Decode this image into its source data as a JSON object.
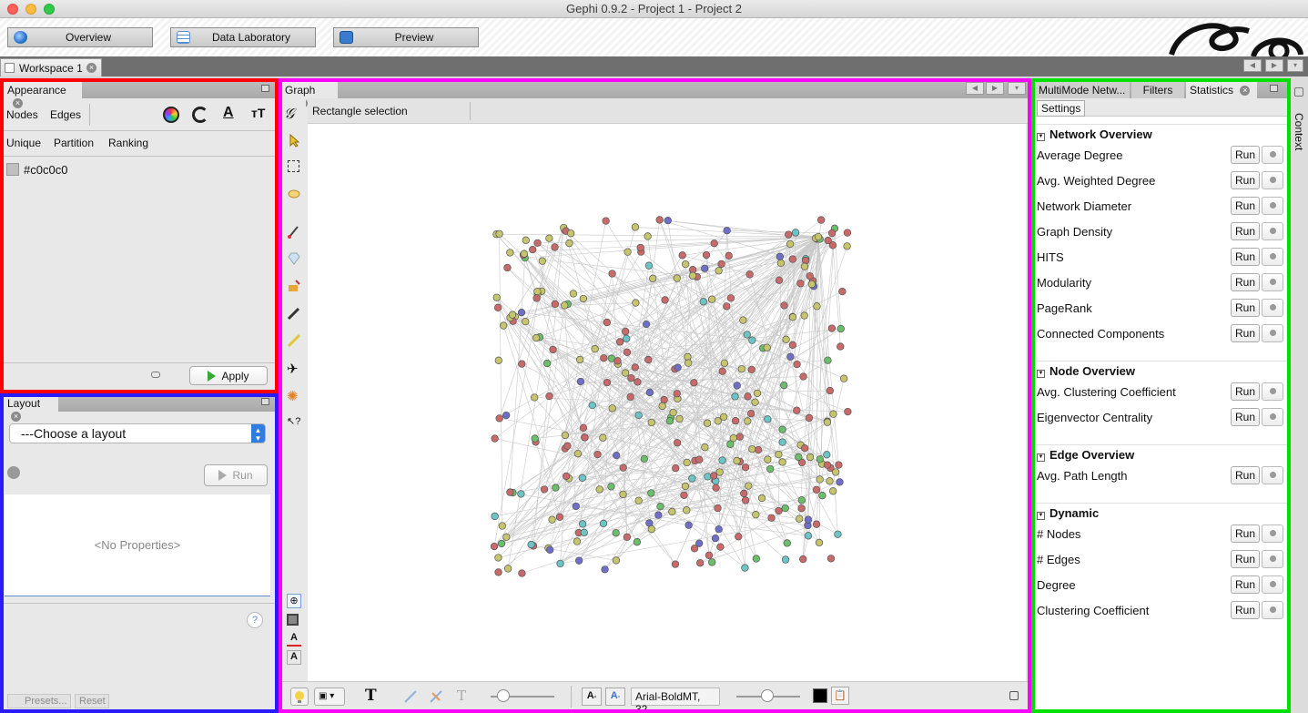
{
  "window": {
    "title": "Gephi 0.9.2 - Project 1 - Project 2"
  },
  "toolbar": {
    "overview": "Overview",
    "data_laboratory": "Data Laboratory",
    "preview": "Preview"
  },
  "workspace": {
    "tab": "Workspace 1"
  },
  "appearance": {
    "tab": "Appearance",
    "nodes": "Nodes",
    "edges": "Edges",
    "modes": [
      "Unique",
      "Partition",
      "Ranking"
    ],
    "color_value": "#c0c0c0",
    "apply": "Apply"
  },
  "layout": {
    "tab": "Layout",
    "choose": "---Choose a layout",
    "run": "Run",
    "no_properties": "<No Properties>",
    "help": "?",
    "presets": "Presets...",
    "reset": "Reset"
  },
  "graph": {
    "tab": "Graph",
    "selection_mode": "Rectangle selection",
    "font": "Arial-BoldMT, 32",
    "font_btn_small": "A",
    "font_btn_large": "A"
  },
  "right": {
    "tabs": [
      "MultiMode Netw...",
      "Filters",
      "Statistics"
    ],
    "settings": "Settings",
    "context": "Context",
    "run_label": "Run",
    "groups": [
      {
        "title": "Network Overview",
        "items": [
          "Average Degree",
          "Avg. Weighted Degree",
          "Network Diameter",
          "Graph Density",
          "HITS",
          "Modularity",
          "PageRank",
          "Connected Components"
        ]
      },
      {
        "title": "Node Overview",
        "items": [
          "Avg. Clustering Coefficient",
          "Eigenvector Centrality"
        ]
      },
      {
        "title": "Edge Overview",
        "items": [
          "Avg. Path Length"
        ]
      },
      {
        "title": "Dynamic",
        "items": [
          "# Nodes",
          "# Edges",
          "Degree",
          "Clustering Coefficient"
        ]
      }
    ]
  },
  "colors": {
    "node_red": "#c96a6a",
    "node_olive": "#c7c46e",
    "node_green": "#6cbf6a",
    "node_teal": "#6cc4c4",
    "node_blue": "#6f6fc8",
    "frame_red": "#ff0000",
    "frame_blue": "#2a1bff",
    "frame_magenta": "#ff00ff",
    "frame_green": "#00e000"
  }
}
